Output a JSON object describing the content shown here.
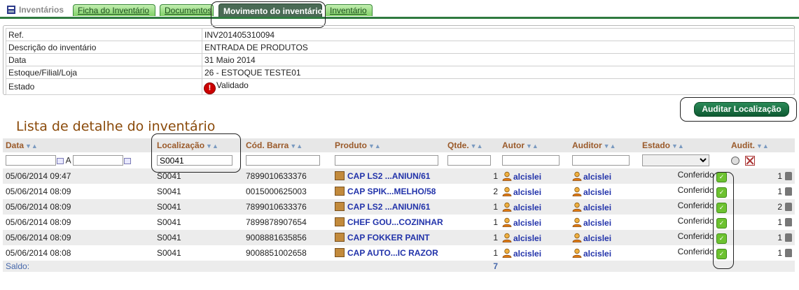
{
  "tabs": {
    "home_label": "Inventários",
    "items": [
      {
        "label": "Ficha do Inventário",
        "active": false
      },
      {
        "label": "Documentos",
        "active": false
      },
      {
        "label": "Movimento do inventário",
        "active": true
      },
      {
        "label": "Inventário",
        "active": false
      }
    ]
  },
  "info": {
    "rows": [
      {
        "label": "Ref.",
        "value": "INV201405310094"
      },
      {
        "label": "Descrição do inventário",
        "value": "ENTRADA DE PRODUTOS"
      },
      {
        "label": "Data",
        "value": "31 Maio 2014"
      },
      {
        "label": "Estoque/Filial/Loja",
        "value": "26 - ESTOQUE TESTE01"
      },
      {
        "label": "Estado",
        "value": "Validado"
      }
    ]
  },
  "audit_button": "Auditar Localização",
  "list_title": "Lista de detalhe do inventário",
  "columns": {
    "data": "Data",
    "localizacao": "Localização",
    "cod_barra": "Cód. Barra",
    "produto": "Produto",
    "qtde": "Qtde.",
    "autor": "Autor",
    "auditor": "Auditor",
    "estado": "Estado",
    "audit": "Audit."
  },
  "filters": {
    "date_from": "",
    "date_sep": "A",
    "date_to": "",
    "localizacao": "S0041",
    "cod_barra": "",
    "produto": "",
    "qtde": "",
    "autor": "",
    "auditor": "",
    "estado": ""
  },
  "rows": [
    {
      "data": "05/06/2014 09:47",
      "loc": "S0041",
      "barra": "7899010633376",
      "produto": "CAP LS2 ...ANIUN/61",
      "qtde": "1",
      "autor": "alcislei",
      "auditor": "alcislei",
      "estado": "Conferido",
      "audit": "1"
    },
    {
      "data": "05/06/2014 08:09",
      "loc": "S0041",
      "barra": "0015000625003",
      "produto": "CAP SPIK...MELHO/58",
      "qtde": "2",
      "autor": "alcislei",
      "auditor": "alcislei",
      "estado": "Conferido",
      "audit": "1"
    },
    {
      "data": "05/06/2014 08:09",
      "loc": "S0041",
      "barra": "7899010633376",
      "produto": "CAP LS2 ...ANIUN/61",
      "qtde": "1",
      "autor": "alcislei",
      "auditor": "alcislei",
      "estado": "Conferido",
      "audit": "2"
    },
    {
      "data": "05/06/2014 08:09",
      "loc": "S0041",
      "barra": "7899878907654",
      "produto": "CHEF GOU...COZINHAR",
      "qtde": "1",
      "autor": "alcislei",
      "auditor": "alcislei",
      "estado": "Conferido",
      "audit": "1"
    },
    {
      "data": "05/06/2014 08:09",
      "loc": "S0041",
      "barra": "9008881635856",
      "produto": "CAP FOKKER PAINT",
      "qtde": "1",
      "autor": "alcislei",
      "auditor": "alcislei",
      "estado": "Conferido",
      "audit": "1"
    },
    {
      "data": "05/06/2014 08:08",
      "loc": "S0041",
      "barra": "9008851002658",
      "produto": "CAP AUTO...IC RAZOR",
      "qtde": "1",
      "autor": "alcislei",
      "auditor": "alcislei",
      "estado": "Conferido",
      "audit": "1"
    }
  ],
  "saldo": {
    "label": "Saldo:",
    "total": "7"
  },
  "icons": {
    "home": "inventory-icon",
    "alert": "alert-icon",
    "product": "box-icon",
    "user": "user-icon",
    "check": "check-icon",
    "trash": "trash-icon",
    "calendar": "calendar-icon",
    "search": "search-icon",
    "clear": "clear-filter-icon"
  },
  "colors": {
    "tab_active": "#4a6a55",
    "tab": "#7fd066",
    "button": "#0e5a32",
    "link": "#2233aa",
    "title": "#8a4a0a"
  }
}
